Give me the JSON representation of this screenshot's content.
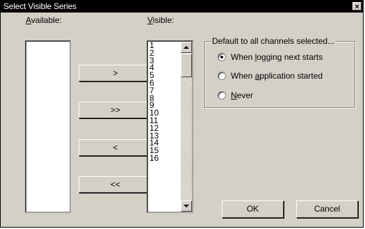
{
  "window": {
    "title": "Select Visible Series",
    "close_icon": "×"
  },
  "available": {
    "label_prefix": "",
    "label_mnemonic": "A",
    "label_rest": "vailable:"
  },
  "visible": {
    "label_mnemonic": "V",
    "label_rest": "isible:",
    "items": [
      "1",
      "2",
      "3",
      "4",
      "5",
      "6",
      "7",
      "8",
      "9",
      "10",
      "11",
      "12",
      "13",
      "14",
      "15",
      "16"
    ]
  },
  "move_buttons": {
    "add": ">",
    "add_all": ">>",
    "remove": "<",
    "remove_all": "<<"
  },
  "group": {
    "title": "Default to all channels selected...",
    "options": [
      {
        "pre": "When ",
        "mn": "l",
        "post": "ogging next starts",
        "selected": true
      },
      {
        "pre": "When ",
        "mn": "a",
        "post": "pplication started",
        "selected": false
      },
      {
        "pre": "",
        "mn": "N",
        "post": "ever",
        "selected": false
      }
    ]
  },
  "footer": {
    "ok": "OK",
    "cancel": "Cancel"
  }
}
